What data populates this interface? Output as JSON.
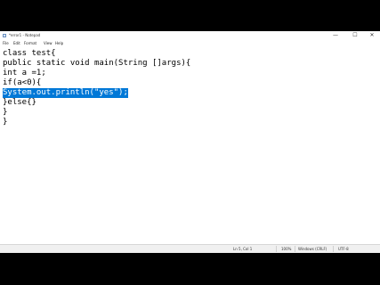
{
  "window": {
    "title": "*error1 - Notepad",
    "controls": {
      "minimize": "—",
      "maximize": "☐",
      "close": "✕"
    }
  },
  "menu": {
    "file": "File",
    "edit": "Edit",
    "format": "Format",
    "view": "View",
    "help": "Help"
  },
  "editor": {
    "lines": [
      "class test{",
      "public static void main(String []args){",
      "int a =1;",
      "if(a<0){",
      "System.out.println(\"yes\");",
      "}else{}",
      "}",
      "}"
    ],
    "selected_line_index": 4,
    "selection_color": "#0078d7"
  },
  "status": {
    "position": "Ln 5, Col 1",
    "zoom": "100%",
    "line_endings": "Windows (CRLF)",
    "encoding": "UTF-8"
  }
}
